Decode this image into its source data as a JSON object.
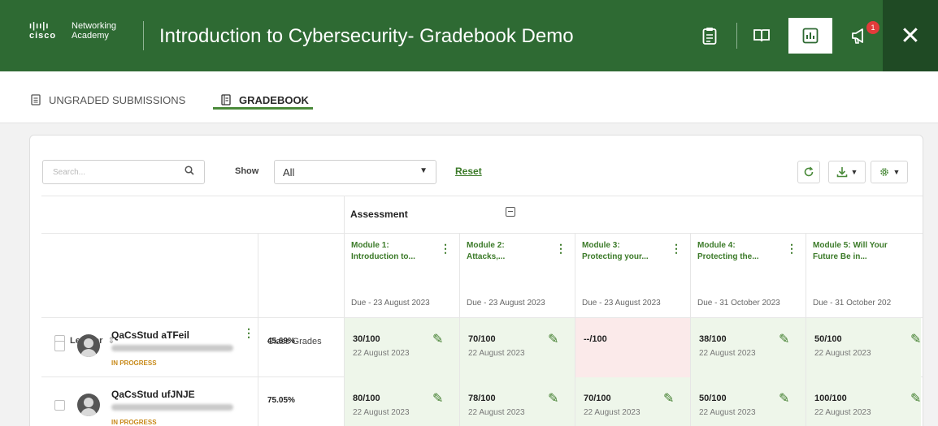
{
  "header": {
    "logo_line1": "Networking",
    "logo_line2": "Academy",
    "logo_brand": "cisco",
    "title": "Introduction to Cybersecurity- Gradebook Demo",
    "notification_count": "1",
    "icons": [
      "clipboard-icon",
      "book-icon",
      "chart-icon",
      "megaphone-icon",
      "close-icon"
    ]
  },
  "tabs": [
    {
      "label": "UNGRADED SUBMISSIONS",
      "active": false
    },
    {
      "label": "GRADEBOOK",
      "active": true
    }
  ],
  "toolbar": {
    "search_placeholder": "Search...",
    "show_label": "Show",
    "show_value": "All",
    "reset_label": "Reset"
  },
  "table": {
    "group_label": "Assessment",
    "learner_header": "Learner",
    "sort_icon": "⇕",
    "class_grades_header": "Class Grades",
    "modules": [
      {
        "title1": "Module 1:",
        "title2": "Introduction to...",
        "due": "Due - 23 August 2023"
      },
      {
        "title1": "Module 2:",
        "title2": "Attacks,...",
        "due": "Due - 23 August 2023"
      },
      {
        "title1": "Module 3:",
        "title2": "Protecting your...",
        "due": "Due - 23 August 2023"
      },
      {
        "title1": "Module 4:",
        "title2": "Protecting the...",
        "due": "Due - 31 October 2023"
      },
      {
        "title1": "Module 5: Will Your",
        "title2": "Future Be in...",
        "due": "Due - 31 October 202"
      }
    ],
    "rows": [
      {
        "name": "QaCsStud aTFeil",
        "status": "IN PROGRESS",
        "class_grade": "45.69%",
        "grades": [
          {
            "value": "30/100",
            "date": "22 August 2023",
            "state": "graded"
          },
          {
            "value": "70/100",
            "date": "22 August 2023",
            "state": "graded"
          },
          {
            "value": "--/100",
            "date": "",
            "state": "missing"
          },
          {
            "value": "38/100",
            "date": "22 August 2023",
            "state": "graded"
          },
          {
            "value": "50/100",
            "date": "22 August 2023",
            "state": "graded"
          }
        ]
      },
      {
        "name": "QaCsStud ufJNJE",
        "status": "IN PROGRESS",
        "class_grade": "75.05%",
        "grades": [
          {
            "value": "80/100",
            "date": "22 August 2023",
            "state": "graded"
          },
          {
            "value": "78/100",
            "date": "22 August 2023",
            "state": "graded"
          },
          {
            "value": "70/100",
            "date": "22 August 2023",
            "state": "graded"
          },
          {
            "value": "50/100",
            "date": "22 August 2023",
            "state": "graded"
          },
          {
            "value": "100/100",
            "date": "22 August 2023",
            "state": "graded"
          }
        ]
      }
    ]
  },
  "colors": {
    "header_bg": "#2e6a33",
    "accent_green": "#3b7a28",
    "graded_bg": "#eef6ea",
    "missing_bg": "#fbeaea",
    "status_color": "#c88a1a"
  }
}
